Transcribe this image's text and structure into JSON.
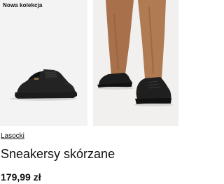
{
  "badge": {
    "label": "Nowa kolekcja"
  },
  "product": {
    "brand": "Lasocki",
    "name": "Sneakersy skórzane",
    "price": "179,99 zł"
  },
  "images": [
    {
      "icon": "sneaker-photo"
    },
    {
      "icon": "model-wearing-sneakers-photo"
    }
  ],
  "colors": {
    "shoe": "#1a1a1a",
    "trousers": "#b07a53",
    "background": "#f3f3f3"
  }
}
